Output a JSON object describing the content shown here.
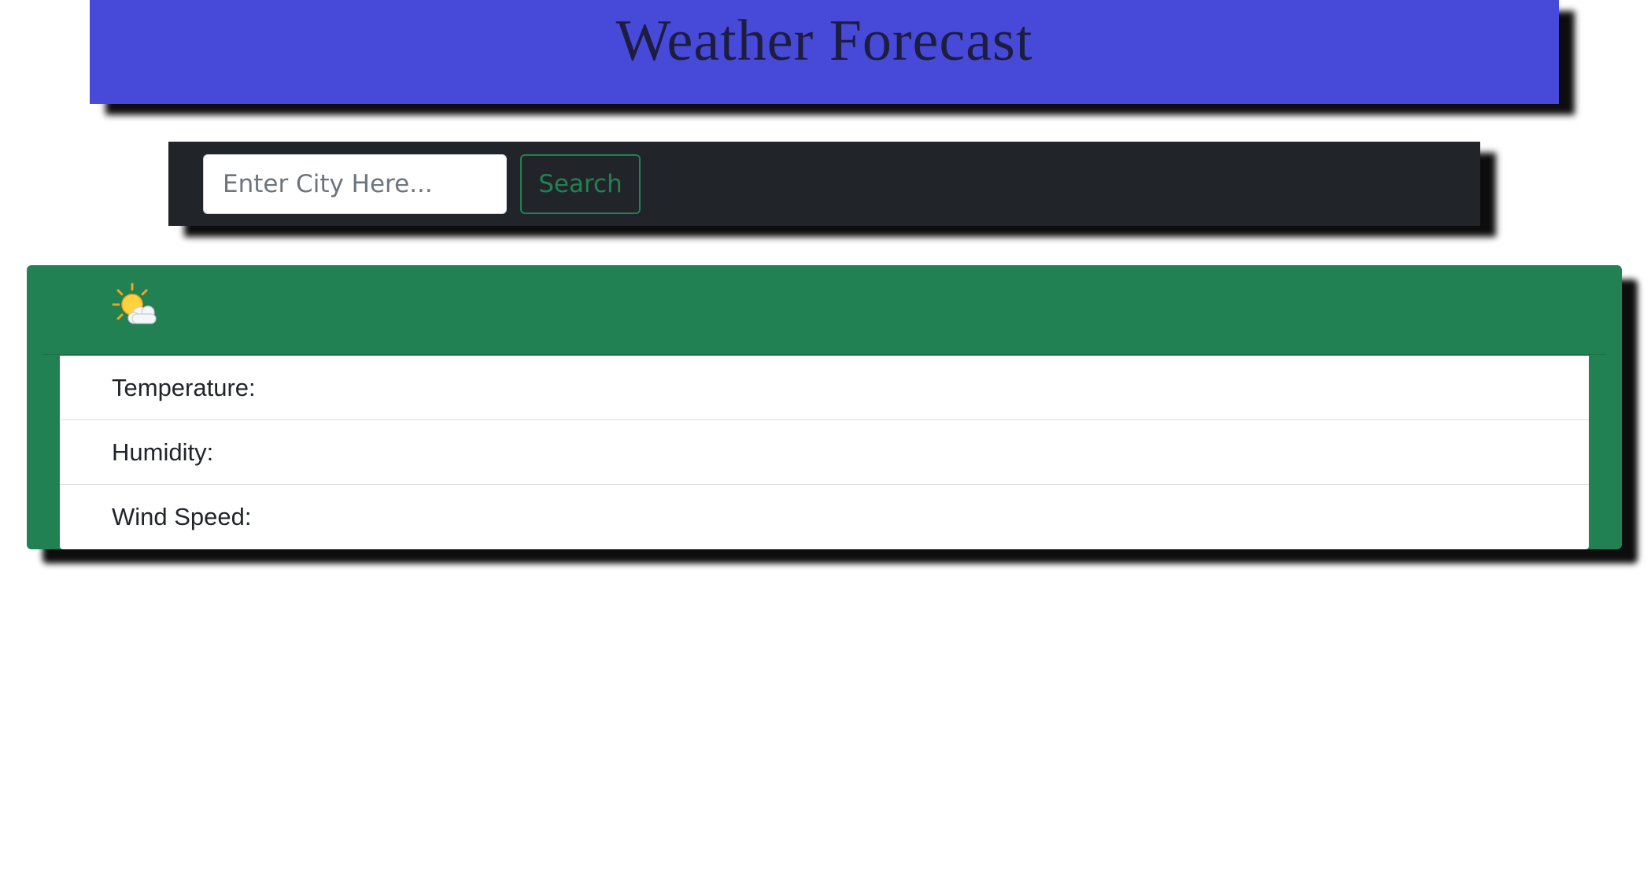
{
  "header": {
    "title": "Weather Forecast",
    "background": "#4749d9"
  },
  "search": {
    "placeholder": "Enter City Here...",
    "value": "",
    "button_label": "Search",
    "bar_background": "#212529",
    "button_color": "#218153"
  },
  "weather_card": {
    "background": "#218153",
    "icon": "sun-behind-cloud-icon",
    "items": [
      {
        "label": "Temperature:"
      },
      {
        "label": "Humidity:"
      },
      {
        "label": "Wind Speed:"
      }
    ]
  }
}
